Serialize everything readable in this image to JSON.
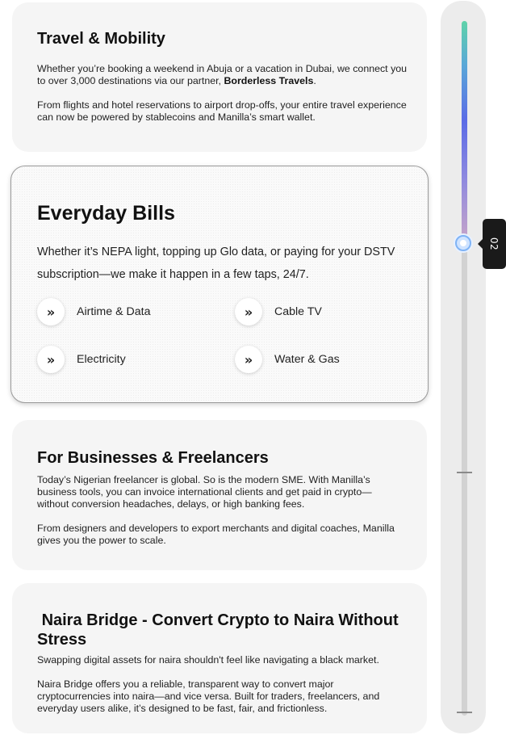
{
  "travel": {
    "title": "Travel & Mobility",
    "p1_pre": "Whether you’re booking a weekend in Abuja or a vacation in Dubai, we connect you to over 3,000 destinations via our partner, ",
    "p1_partner": "Borderless Travels",
    "p1_post": ".",
    "p2": "From flights and hotel reservations to airport drop-offs, your entire travel experience can now be powered by stablecoins and Manilla’s smart wallet."
  },
  "bills": {
    "title": "Everyday Bills",
    "description": "Whether it’s NEPA light, topping up Glo data, or paying for your DSTV subscription—we make it happen in a few taps, 24/7.",
    "icon_glyph": "»",
    "items": [
      {
        "label": "Airtime & Data",
        "icon": "double-chevron-right-icon"
      },
      {
        "label": "Cable TV",
        "icon": "double-chevron-right-icon"
      },
      {
        "label": "Electricity",
        "icon": "double-chevron-right-icon"
      },
      {
        "label": "Water & Gas",
        "icon": "double-chevron-right-icon"
      }
    ]
  },
  "business": {
    "title": "For Businesses & Freelancers",
    "p1": "Today’s Nigerian freelancer is global. So is the modern SME. With Manilla’s business tools, you can invoice international clients and get paid in crypto—without conversion headaches, delays, or high banking fees.",
    "p2": "From designers and developers to export merchants and digital coaches, Manilla gives you the power to scale."
  },
  "naira": {
    "title": " Naira Bridge - Convert Crypto to Naira Without Stress",
    "p1": "Swapping digital assets for naira shouldn't feel like navigating a black market.",
    "p2": "Naira Bridge offers you a reliable, transparent way to convert major cryptocurrencies into naira—and vice versa. Built for traders, freelancers, and everyday users alike, it’s designed to be fast, fair, and frictionless."
  },
  "slider": {
    "value_label": "02",
    "progress": 0.32,
    "colors": {
      "fill_top": "#5ed3a9",
      "fill_mid": "#5b6be6",
      "thumb": "#7fb3f5",
      "track": "#d2d2d2"
    }
  }
}
